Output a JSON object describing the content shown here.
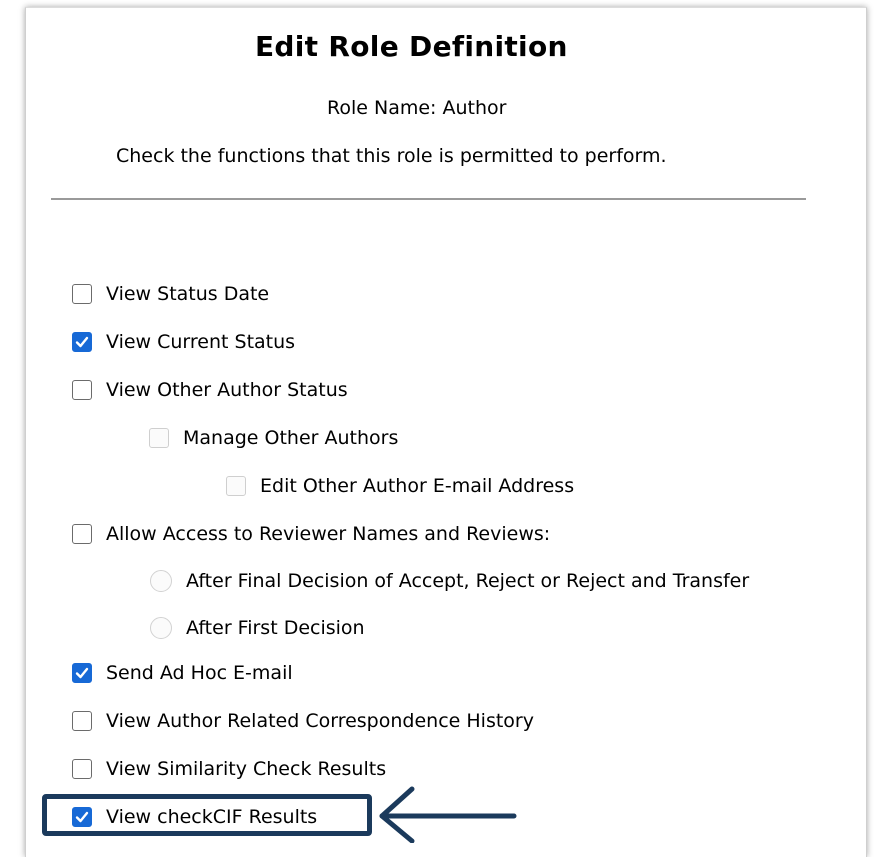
{
  "header": {
    "title": "Edit Role Definition",
    "role_name": "Role Name: Author",
    "instructions": "Check the functions that this role is permitted to perform."
  },
  "options": [
    {
      "label": "View Status Date",
      "type": "checkbox",
      "checked": false,
      "disabled": false
    },
    {
      "label": "View Current Status",
      "type": "checkbox",
      "checked": true,
      "disabled": false
    },
    {
      "label": "View Other Author Status",
      "type": "checkbox",
      "checked": false,
      "disabled": false
    },
    {
      "label": "Manage Other Authors",
      "type": "checkbox",
      "checked": false,
      "disabled": true
    },
    {
      "label": "Edit Other Author E-mail Address",
      "type": "checkbox",
      "checked": false,
      "disabled": true
    },
    {
      "label": "Allow Access to Reviewer Names and Reviews:",
      "type": "checkbox",
      "checked": false,
      "disabled": false
    },
    {
      "label": "After Final Decision of Accept, Reject or Reject and Transfer",
      "type": "radio",
      "checked": false,
      "disabled": true
    },
    {
      "label": "After First Decision",
      "type": "radio",
      "checked": false,
      "disabled": true
    },
    {
      "label": "Send Ad Hoc E-mail",
      "type": "checkbox",
      "checked": true,
      "disabled": false
    },
    {
      "label": "View Author Related Correspondence History",
      "type": "checkbox",
      "checked": false,
      "disabled": false
    },
    {
      "label": "View Similarity Check Results",
      "type": "checkbox",
      "checked": false,
      "disabled": false
    },
    {
      "label": "View checkCIF Results",
      "type": "checkbox",
      "checked": true,
      "disabled": false
    }
  ],
  "colors": {
    "checkbox_checked": "#1769d6",
    "highlight_box": "#1b3a5c",
    "arrow": "#1b3a5c"
  },
  "annotation": {
    "highlighted_option": "View checkCIF Results",
    "pointer_icon": "left-arrow-icon"
  }
}
